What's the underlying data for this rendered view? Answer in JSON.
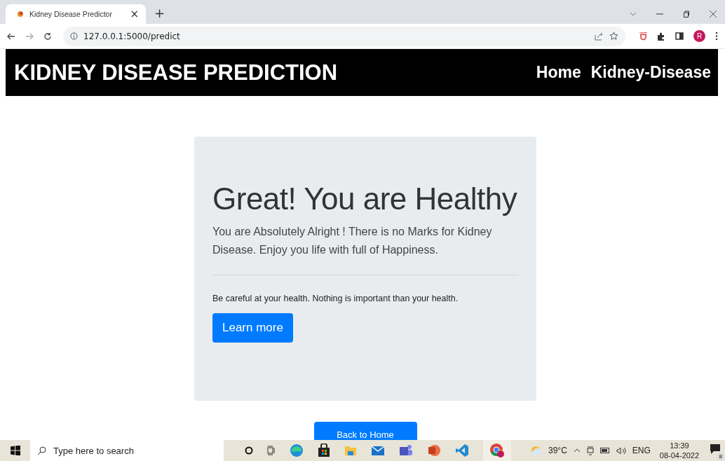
{
  "browser": {
    "tab": {
      "title": "Kidney Disease Predictor",
      "close": "×"
    },
    "new_tab": "+",
    "url": "127.0.0.1:5000/predict",
    "profile_initial": "R"
  },
  "navbar": {
    "brand": "KIDNEY DISEASE PREDICTION",
    "links": [
      {
        "label": "Home"
      },
      {
        "label": "Kidney-Disease"
      }
    ]
  },
  "card": {
    "heading": "Great! You are Healthy",
    "lead": "You are Absolutely Alright ! There is no Marks for Kidney Disease. Enjoy you life with full of Happiness.",
    "message": "Be careful at your health. Nothing is important than your health.",
    "button": "Learn more"
  },
  "back_button": "Back to Home",
  "taskbar": {
    "search": {
      "placeholder": "Type here to search"
    },
    "temperature": "39°C",
    "language": "ENG",
    "time": "13:39",
    "date": "08-04-2022",
    "notifications": "8"
  }
}
